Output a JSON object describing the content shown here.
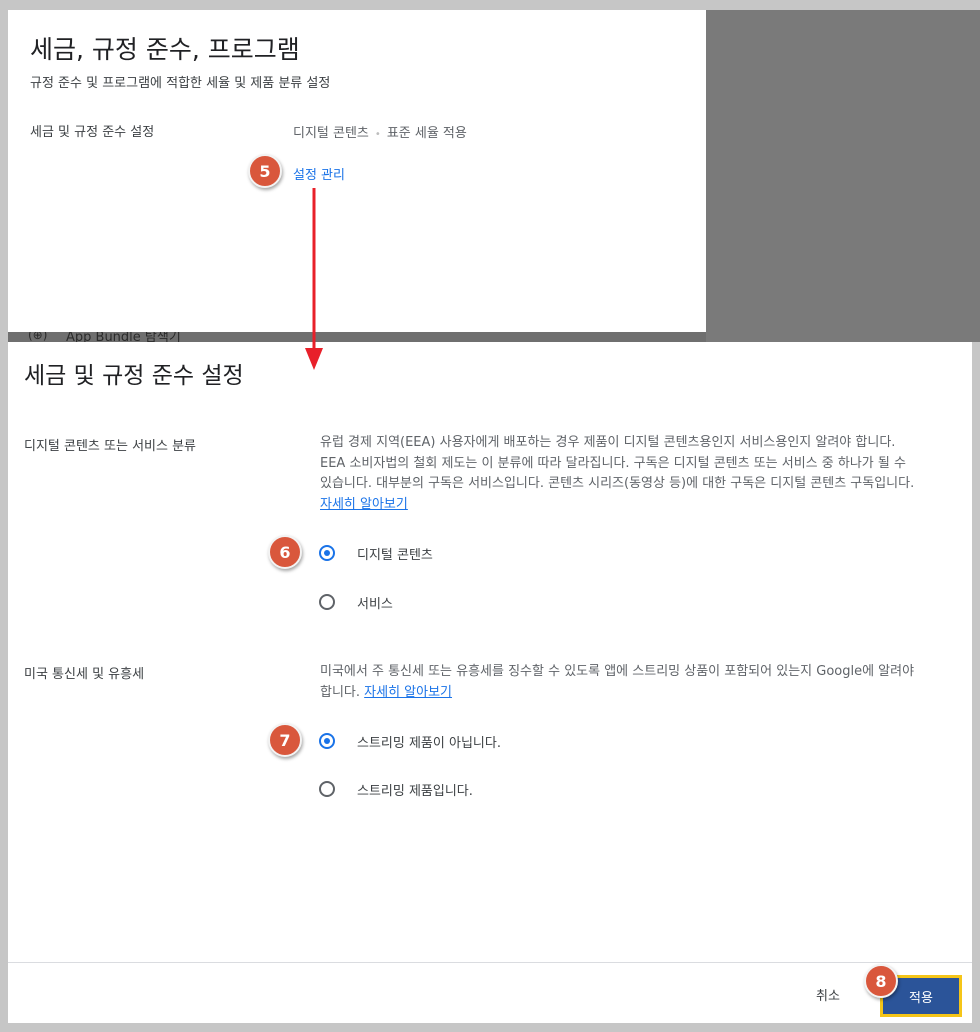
{
  "top_panel": {
    "title": "세금, 규정 준수, 프로그램",
    "subtitle": "규정 준수 및 프로그램에 적합한 세율 및 제품 분류 설정",
    "row_label": "세금 및 규정 준수 설정",
    "row_value_1": "디지털 콘텐츠",
    "row_value_2": "표준 세율 적용",
    "dot": "•",
    "manage_link": "설정 관리"
  },
  "background_strip": {
    "icon": "(⊕)",
    "text": "App Bundle 탐색기"
  },
  "dialog": {
    "title": "세금 및 규정 준수 설정",
    "digital_section": {
      "label": "디지털 콘텐츠 또는 서비스 분류",
      "description": "유럽 경제 지역(EEA) 사용자에게 배포하는 경우 제품이 디지털 콘텐츠용인지 서비스용인지 알려야 합니다. EEA 소비자법의 철회 제도는 이 분류에 따라 달라집니다. 구독은 디지털 콘텐츠 또는 서비스 중 하나가 될 수 있습니다. 대부분의 구독은 서비스입니다. 콘텐츠 시리즈(동영상 등)에 대한 구독은 디지털 콘텐츠 구독입니다.",
      "learn_more": "자세히 알아보기",
      "options": [
        {
          "label": "디지털 콘텐츠",
          "selected": true
        },
        {
          "label": "서비스",
          "selected": false
        }
      ]
    },
    "us_section": {
      "label": "미국 통신세 및 유흥세",
      "description": "미국에서 주 통신세 또는 유흥세를 징수할 수 있도록 앱에 스트리밍 상품이 포함되어 있는지 Google에 알려야 합니다.",
      "learn_more": "자세히 알아보기",
      "options": [
        {
          "label": "스트리밍 제품이 아닙니다.",
          "selected": true
        },
        {
          "label": "스트리밍 제품입니다.",
          "selected": false
        }
      ]
    },
    "footer": {
      "cancel": "취소",
      "apply": "적용"
    }
  },
  "annotations": {
    "badges": [
      "5",
      "6",
      "7",
      "8"
    ],
    "badge_color": "#d9573c",
    "arrow_color": "#e8202a",
    "highlight_color": "#f5c518"
  },
  "colors": {
    "accent": "#1a73e8",
    "apply_button": "#2b5499"
  }
}
